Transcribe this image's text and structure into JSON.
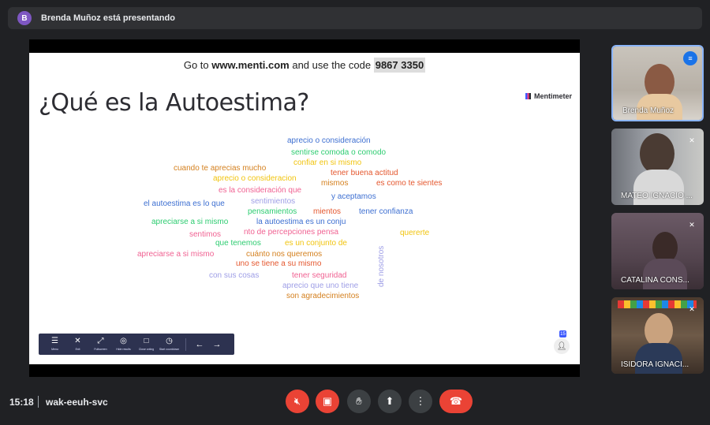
{
  "banner": {
    "avatar_letter": "B",
    "text": "Brenda Muñoz está presentando"
  },
  "slide": {
    "goto_prefix": "Go to ",
    "goto_site": "www.menti.com",
    "goto_mid": " and use the code ",
    "goto_code": "9867 3350",
    "question": "¿Qué es la Autoestima?",
    "brand": "Mentimeter",
    "words": [
      {
        "text": "aprecio o consideración",
        "color": "#3d6fd1"
      },
      {
        "text": "sentirse comoda o comodo",
        "color": "#2ecc71"
      },
      {
        "text": "confiar en si mismo",
        "color": "#f1c40f"
      },
      {
        "text": "cuando te aprecias mucho",
        "color": "#d4801f"
      },
      {
        "text": "tener buena actitud",
        "color": "#e4572e"
      },
      {
        "text": "aprecio o consideracion",
        "color": "#f1c40f"
      },
      {
        "text": "mismos",
        "color": "#d4801f"
      },
      {
        "text": "es como te sientes",
        "color": "#e4572e"
      },
      {
        "text": "es la consideración que",
        "color": "#f06292"
      },
      {
        "text": "sentimientos",
        "color": "#9e9ee6"
      },
      {
        "text": "y aceptamos",
        "color": "#3d6fd1"
      },
      {
        "text": "el autoestima es lo que",
        "color": "#3d6fd1"
      },
      {
        "text": "pensamientos",
        "color": "#2ecc71"
      },
      {
        "text": "mientos",
        "color": "#e4572e"
      },
      {
        "text": "tener confianza",
        "color": "#3d6fd1"
      },
      {
        "text": "apreciarse a si mismo",
        "color": "#2ecc71"
      },
      {
        "text": "la autoestima es un conju",
        "color": "#3d6fd1"
      },
      {
        "text": "sentimos",
        "color": "#f06292"
      },
      {
        "text": "nto de percepciones pensa",
        "color": "#f06292"
      },
      {
        "text": "quererte",
        "color": "#f1c40f"
      },
      {
        "text": "que tenemos",
        "color": "#2ecc71"
      },
      {
        "text": "es un conjunto de",
        "color": "#f1c40f"
      },
      {
        "text": "apreciarse a si mismo",
        "color": "#f06292"
      },
      {
        "text": "cuánto nos queremos",
        "color": "#d4801f"
      },
      {
        "text": "uno se tiene a su mismo",
        "color": "#e4572e"
      },
      {
        "text": "con sus cosas",
        "color": "#9e9ee6"
      },
      {
        "text": "tener seguridad",
        "color": "#f06292"
      },
      {
        "text": "aprecio que uno tiene",
        "color": "#9e9ee6"
      },
      {
        "text": "son agradecimientos",
        "color": "#d4801f"
      }
    ],
    "vertical_word": "de nosotros",
    "toolbar": {
      "items": [
        {
          "icon": "menu-icon",
          "label": "Menu"
        },
        {
          "icon": "close-icon",
          "label": "Exit"
        },
        {
          "icon": "fullscreen-icon",
          "label": "Fullscreen"
        },
        {
          "icon": "hide-results-icon",
          "label": "Hide results"
        },
        {
          "icon": "lock-icon",
          "label": "Close voting"
        },
        {
          "icon": "timer-icon",
          "label": "Start countdown"
        }
      ]
    },
    "participants_count": "15"
  },
  "participants": [
    {
      "name": "Brenda Muñoz",
      "speaking": true
    },
    {
      "name": "MATEO IGNACIO ...",
      "muted": true
    },
    {
      "name": "CATALINA CONS...",
      "muted": true
    },
    {
      "name": "ISIDORA IGNACI...",
      "muted": true
    }
  ],
  "meeting": {
    "time": "15:18",
    "code": "wak-eeuh-svc"
  }
}
